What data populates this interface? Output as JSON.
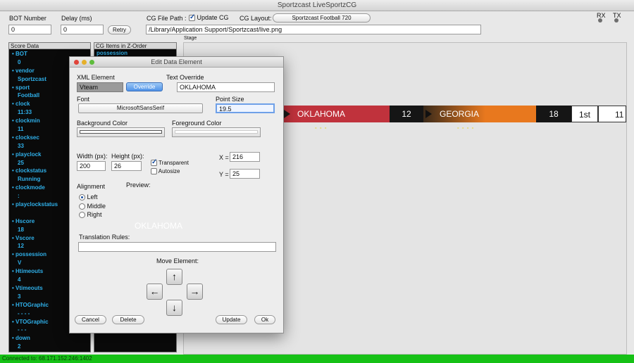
{
  "window": {
    "title": "Sportzcast LiveSportzCG"
  },
  "toolbar": {
    "bot_number_label": "BOT Number",
    "bot_number_value": "0",
    "delay_label": "Delay (ms)",
    "delay_value": "0",
    "retry_label": "Retry",
    "cg_file_path_label": "CG File Path :",
    "update_cg_label": "Update CG",
    "cg_layout_label": "CG Layout:",
    "cg_layout_value": "Sportzcast Football 720",
    "file_path_value": "/Library/Application Support/Sportzcast/live.png",
    "rx_label": "RX",
    "tx_label": "TX",
    "stage_label": "Stage"
  },
  "score_data": {
    "header": "Score Data",
    "items": [
      {
        "key": "BOT",
        "value": "0"
      },
      {
        "key": "vendor",
        "value": "Sportzcast"
      },
      {
        "key": "sport",
        "value": "Football"
      },
      {
        "key": "clock",
        "value": "11:33"
      },
      {
        "key": "clockmin",
        "value": "11"
      },
      {
        "key": "clocksec",
        "value": "33"
      },
      {
        "key": "playclock",
        "value": "25"
      },
      {
        "key": "clockstatus",
        "value": "Running"
      },
      {
        "key": "clockmode",
        "value": ":"
      },
      {
        "key": "playclockstatus",
        "value": ""
      },
      {
        "key": "Hscore",
        "value": "18"
      },
      {
        "key": "Vscore",
        "value": "12"
      },
      {
        "key": "possession",
        "value": "V"
      },
      {
        "key": "Htimeouts",
        "value": "4"
      },
      {
        "key": "Vtimeouts",
        "value": "3"
      },
      {
        "key": "HTOGraphic",
        "value": "- - - -"
      },
      {
        "key": "VTOGraphic",
        "value": "- - -"
      },
      {
        "key": "down",
        "value": "2"
      }
    ]
  },
  "cg_items": {
    "header": "CG Items in Z-Order",
    "first_item": "possession"
  },
  "scorebug": {
    "visitor_team": "OKLAHOMA",
    "visitor_score": "12",
    "home_team": "GEORGIA",
    "home_score": "18",
    "quarter": "1st",
    "clock_partial": "11",
    "visitor_color": "#c0323c",
    "home_color": "#e8781e"
  },
  "dialog": {
    "title": "Edit Data Element",
    "xml_element_label": "XML Element",
    "xml_element_value": "Vteam",
    "override_label": "Override",
    "text_override_label": "Text Override",
    "text_override_value": "OKLAHOMA",
    "font_label": "Font",
    "font_value": "MicrosoftSansSerif",
    "point_size_label": "Point Size",
    "point_size_value": "19.5",
    "background_color_label": "Background Color",
    "foreground_color_label": "Foreground Color",
    "width_label": "Width (px):",
    "width_value": "200",
    "height_label": "Height (px):",
    "height_value": "26",
    "transparent_label": "Transparent",
    "autosize_label": "Autosize",
    "x_label": "X =",
    "x_value": "216",
    "y_label": "Y =",
    "y_value": "25",
    "alignment_label": "Alignment",
    "preview_label": "Preview:",
    "align_left": "Left",
    "align_middle": "Middle",
    "align_right": "Right",
    "preview_text": "OKLAHOMA",
    "translation_rules_label": "Translation Rules:",
    "translation_rules_value": "",
    "move_element_label": "Move Element:",
    "up_arrow": "↑",
    "down_arrow": "↓",
    "left_arrow": "←",
    "right_arrow": "→",
    "cancel_label": "Cancel",
    "delete_label": "Delete",
    "update_label": "Update",
    "ok_label": "Ok"
  },
  "status": {
    "text": "Connected to: 68.171.152.246:1402",
    "color": "#16c116"
  }
}
